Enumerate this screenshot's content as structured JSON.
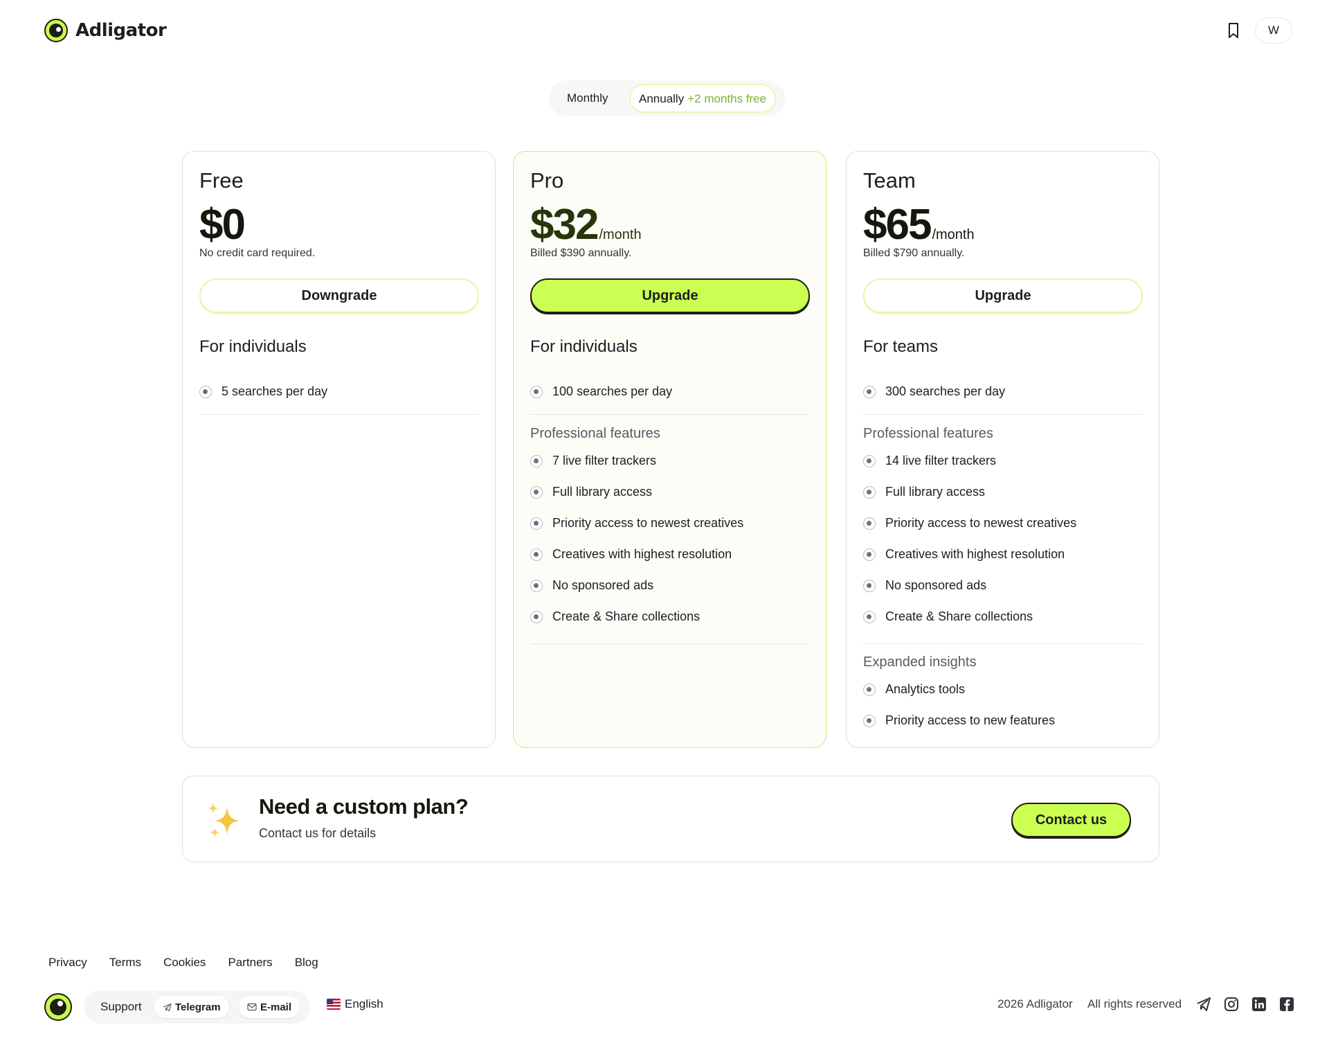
{
  "header": {
    "brand": "Adligator",
    "avatar_initial": "W"
  },
  "billing_toggle": {
    "monthly_label": "Monthly",
    "annual_label": "Annually",
    "annual_badge": "+2 months free",
    "selected": "Annually"
  },
  "plans": [
    {
      "name": "Free",
      "price": "$0",
      "per": "",
      "note": "No credit card required.",
      "cta": "Downgrade",
      "audience": "For individuals",
      "base_features": [
        "5 searches per day"
      ]
    },
    {
      "name": "Pro",
      "price": "$32",
      "per": "/month",
      "note": "Billed $390 annually.",
      "cta": "Upgrade",
      "audience": "For individuals",
      "base_features": [
        "100 searches per day"
      ],
      "professional_title": "Professional features",
      "professional_features": [
        "7 live filter trackers",
        "Full library access",
        "Priority access to newest creatives",
        "Creatives with highest resolution",
        "No sponsored ads",
        "Create & Share collections"
      ]
    },
    {
      "name": "Team",
      "price": "$65",
      "per": "/month",
      "note": "Billed $790 annually.",
      "cta": "Upgrade",
      "audience": "For teams",
      "base_features": [
        "300 searches per day"
      ],
      "professional_title": "Professional features",
      "professional_features": [
        "14 live filter trackers",
        "Full library access",
        "Priority access to newest creatives",
        "Creatives with highest resolution",
        "No sponsored ads",
        "Create & Share collections"
      ],
      "insights_title": "Expanded insights",
      "insights_features": [
        "Analytics tools",
        "Priority access to new features"
      ]
    }
  ],
  "custom_plan": {
    "title": "Need a custom plan?",
    "subtitle": "Contact us for details",
    "cta": "Contact us"
  },
  "footer": {
    "links": [
      "Privacy",
      "Terms",
      "Cookies",
      "Partners",
      "Blog"
    ],
    "support_label": "Support",
    "telegram_label": "Telegram",
    "email_label": "E-mail",
    "language": "English",
    "copyright": "2026 Adligator",
    "rights": "All rights reserved"
  },
  "colors": {
    "accent": "#cbff52",
    "accent_border": "#e4f7aa",
    "pro_card_border": "#ccec6f",
    "text": "#1b1e24"
  },
  "icons": [
    "logo-icon",
    "bookmark-icon",
    "feature-bullet-icon",
    "sparkles-icon",
    "telegram-icon",
    "email-icon",
    "us-flag-icon",
    "telegram-social-icon",
    "instagram-icon",
    "linkedin-icon",
    "facebook-icon"
  ]
}
